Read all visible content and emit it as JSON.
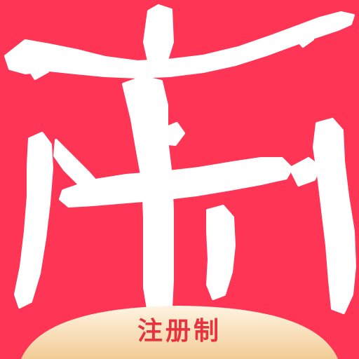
{
  "app_icon": {
    "background_color": "#ff3555",
    "glyph_color": "#ffffff",
    "glyph_icon": "calligraphy-seal-character-icon",
    "ribbon": {
      "label": "注册制",
      "gradient_light": "#fff4e2",
      "gradient_dark": "#f2cc95",
      "text_color": "#e8323d"
    }
  }
}
